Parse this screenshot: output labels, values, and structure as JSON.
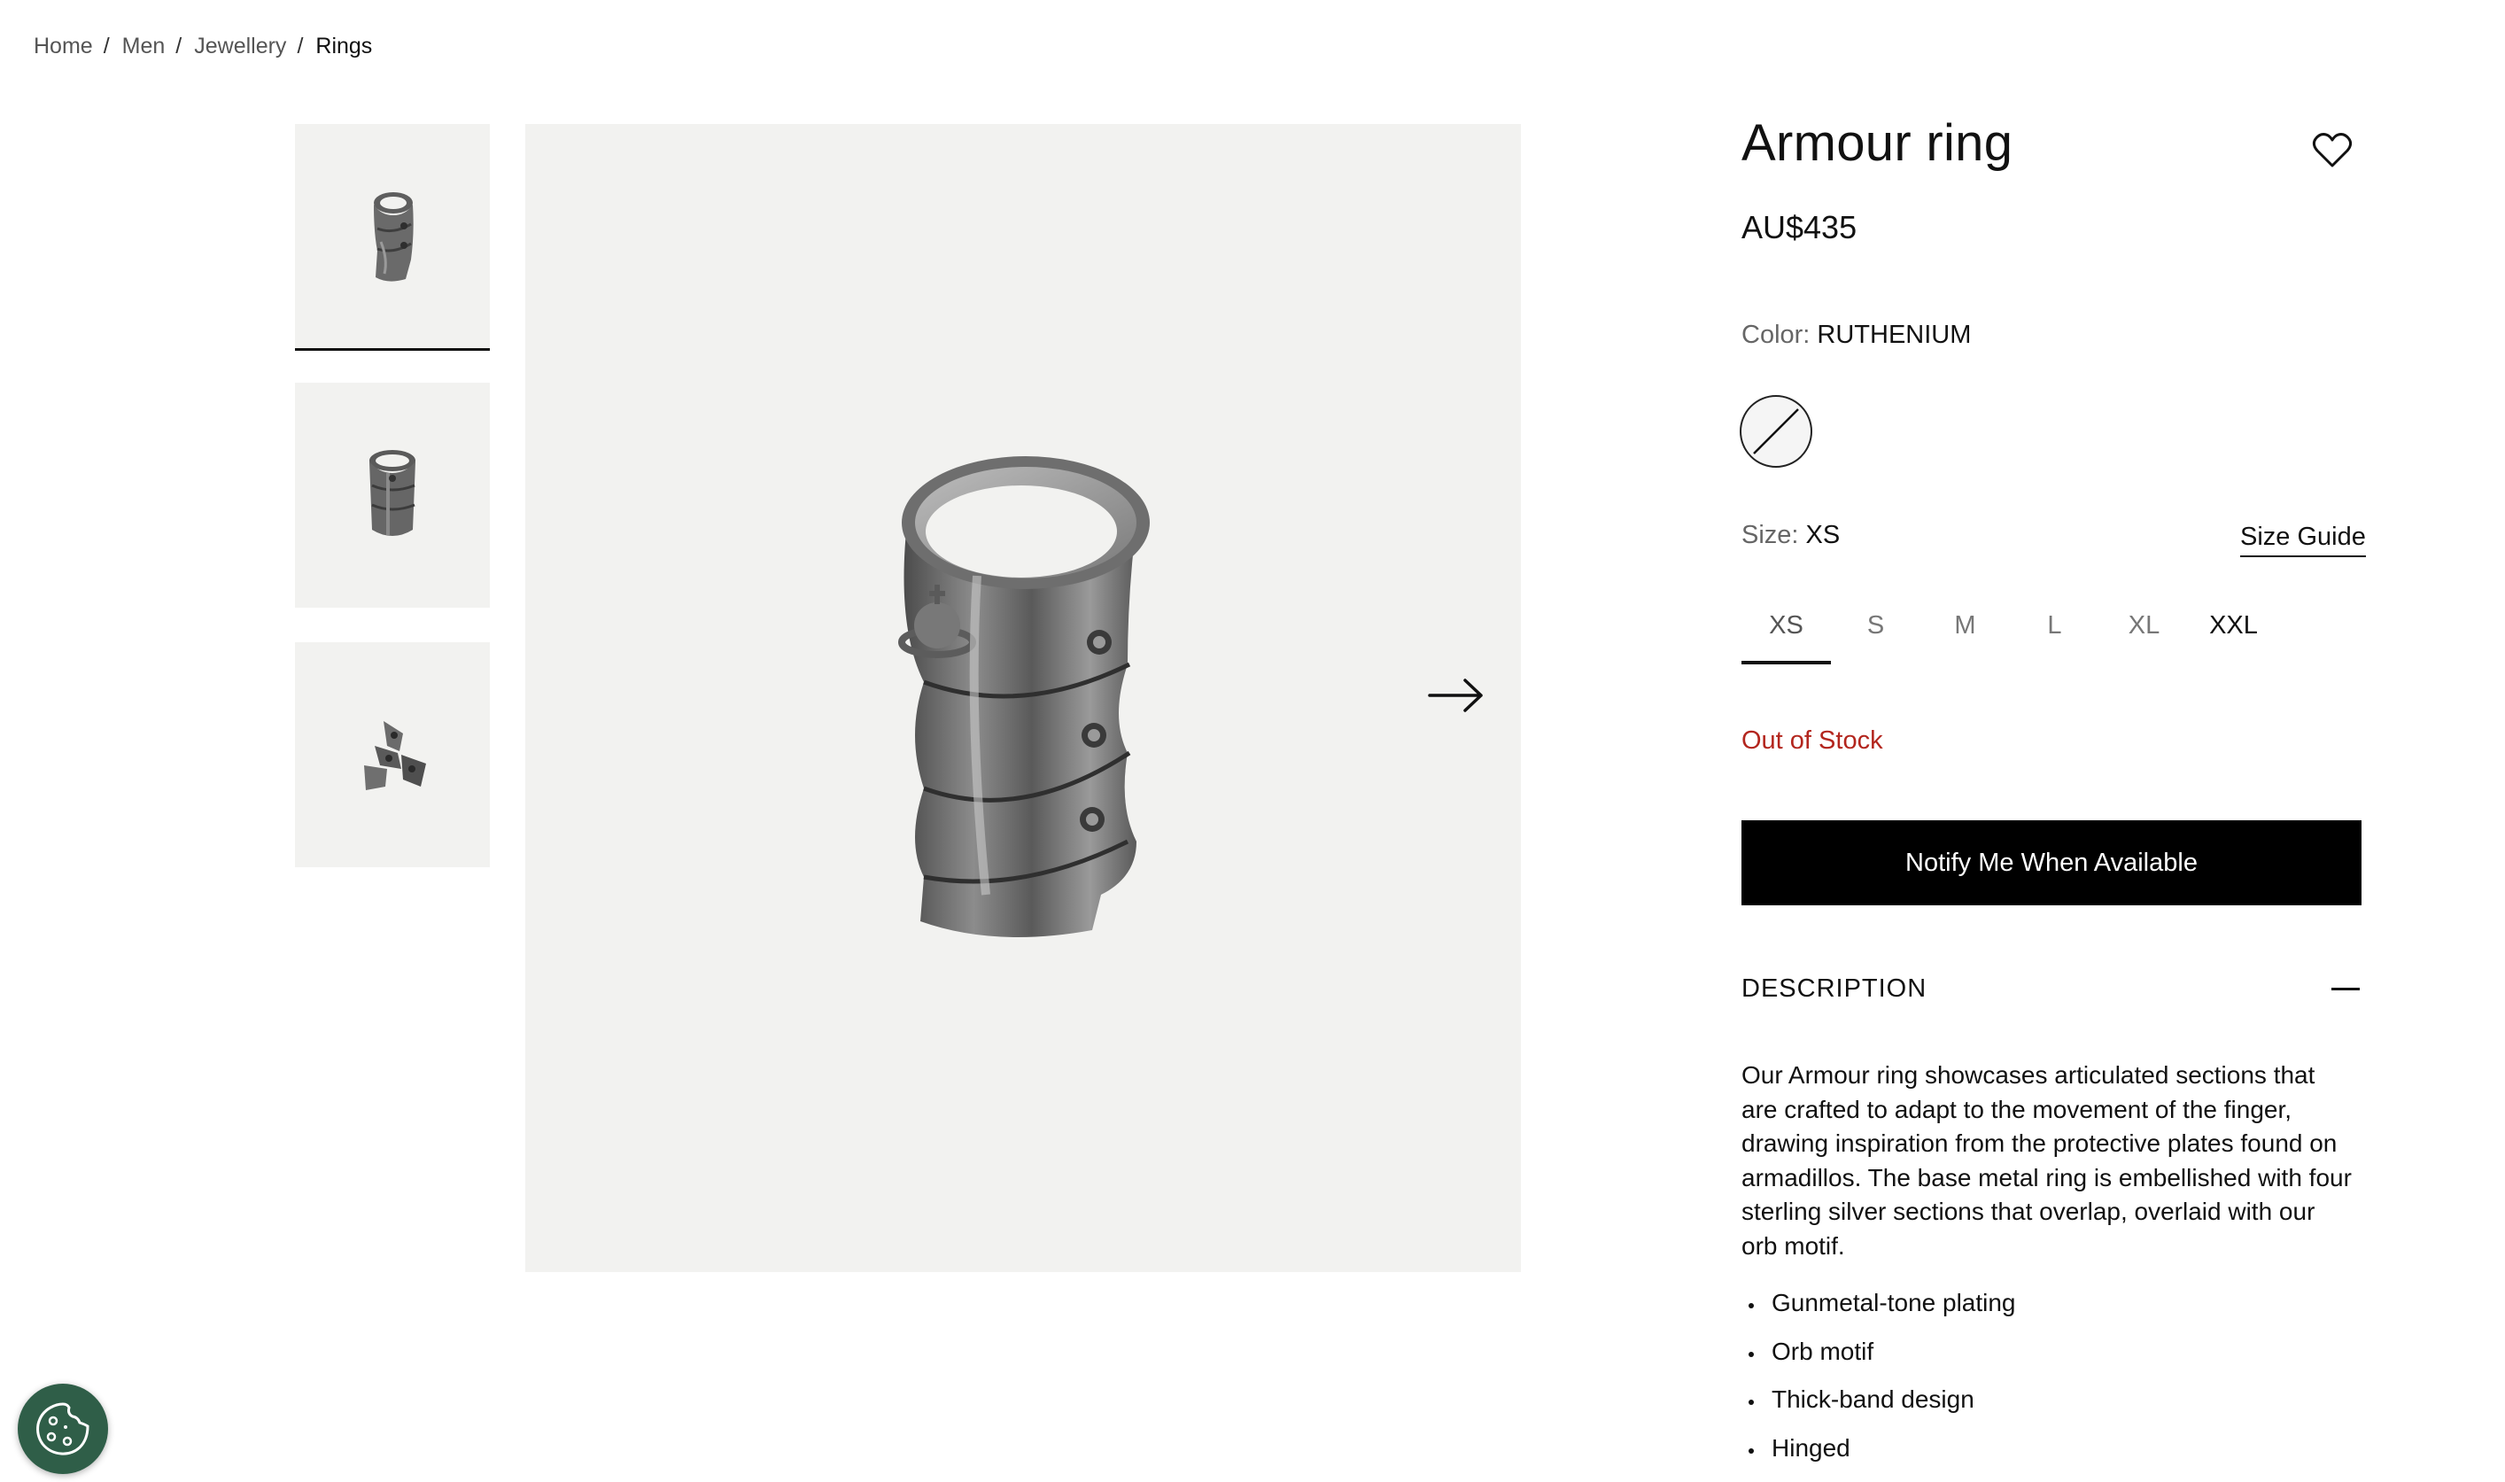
{
  "breadcrumb": {
    "items": [
      "Home",
      "Men",
      "Jewellery",
      "Rings"
    ],
    "separator": "/"
  },
  "product": {
    "title": "Armour ring",
    "price": "AU$435",
    "color_label": "Color:",
    "color_value": "RUTHENIUM",
    "size_label": "Size:",
    "size_value": "XS",
    "size_guide": "Size Guide",
    "sizes": [
      "XS",
      "S",
      "M",
      "L",
      "XL",
      "XXL"
    ],
    "selected_size": "XS",
    "stock_status": "Out of Stock",
    "notify_button": "Notify Me When Available",
    "description_heading": "DESCRIPTION",
    "description": "Our Armour ring showcases articulated sections that are crafted to adapt to the movement of the finger, drawing inspiration from the protective plates found on armadillos. The base metal ring is embellished with four sterling silver sections that overlap, overlaid with our orb motif.",
    "features": [
      "Gunmetal-tone plating",
      "Orb motif",
      "Thick-band design",
      "Hinged"
    ]
  },
  "gallery": {
    "thumbnails": [
      "ring-front-thumbnail",
      "ring-side-thumbnail",
      "ring-open-thumbnail"
    ],
    "selected_index": 0
  },
  "icons": {
    "wishlist": "heart-icon",
    "next": "arrow-right-icon",
    "collapse": "minus-icon",
    "cookie": "cookie-icon"
  },
  "colors": {
    "accent": "#000000",
    "stock_error": "#b3261e",
    "image_bg": "#f2f2f0",
    "cookie_bg": "#2f5e48"
  }
}
